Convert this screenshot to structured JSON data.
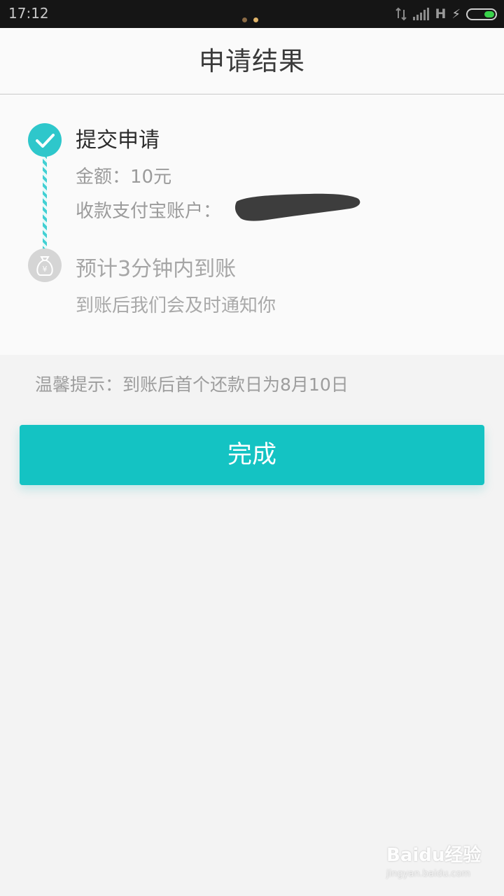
{
  "status_bar": {
    "time": "17:12",
    "network": "H",
    "icons": [
      "data-arrows-icon",
      "signal-icon",
      "charging-bolt-icon",
      "battery-icon"
    ],
    "dot_colors": [
      "#8a6a45",
      "#e0b46a"
    ]
  },
  "header": {
    "title": "申请结果"
  },
  "steps": [
    {
      "icon": "check-icon",
      "title": "提交申请",
      "amount": "金额：10元",
      "account_label": "收款支付宝账户：",
      "account_value_redacted": true
    },
    {
      "icon": "money-bag-icon",
      "title": "预计3分钟内到账",
      "note": "到账后我们会及时通知你"
    }
  ],
  "tip": "温馨提示：到账后首个还款日为8月10日",
  "button": {
    "label": "完成"
  },
  "watermark": {
    "brand": "Baidu经验",
    "url": "jingyan.baidu.com"
  },
  "colors": {
    "accent": "#14c3c3",
    "step_done": "#2ec7cb",
    "step_pending": "#d5d5d5"
  }
}
